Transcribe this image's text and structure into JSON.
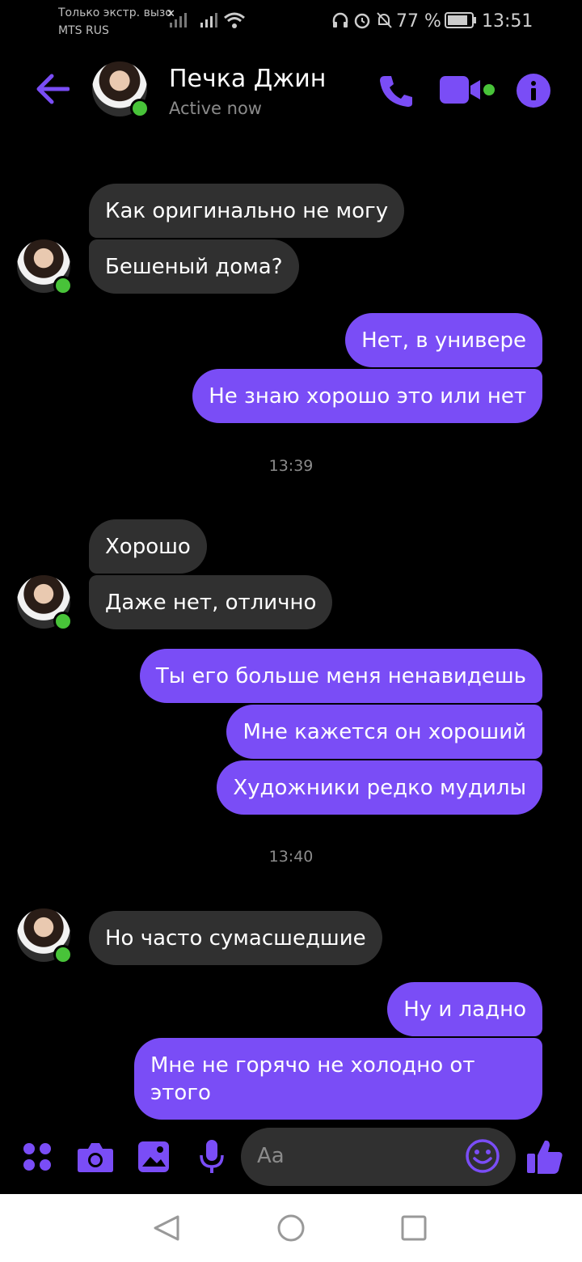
{
  "status_bar": {
    "carrier_line1": "Только экстр. вызо",
    "carrier_line2": "MTS RUS",
    "battery": "77 %",
    "time": "13:51"
  },
  "header": {
    "contact_name": "Печка Джин",
    "status": "Active now",
    "icons": [
      "back-arrow-icon",
      "phone-icon",
      "video-camera-icon",
      "info-icon"
    ]
  },
  "messages": [
    {
      "side": "in",
      "text": "Как оригинально не могу"
    },
    {
      "side": "in",
      "text": "Бешеный дома?"
    },
    {
      "side": "out",
      "text": "Нет, в универе"
    },
    {
      "side": "out",
      "text": "Не знаю хорошо это или нет"
    },
    {
      "timestamp": "13:39"
    },
    {
      "side": "in",
      "text": "Хорошо"
    },
    {
      "side": "in",
      "text": "Даже нет, отлично"
    },
    {
      "side": "out",
      "text": "Ты его больше меня ненавидешь"
    },
    {
      "side": "out",
      "text": "Мне кажется он хороший"
    },
    {
      "side": "out",
      "text": "Художники редко мудилы"
    },
    {
      "timestamp": "13:40"
    },
    {
      "side": "in",
      "text": "Но часто сумасшедшие"
    },
    {
      "side": "out",
      "text": "Ну и ладно"
    },
    {
      "side": "out",
      "text": "Мне не горячо не холодно от этого"
    }
  ],
  "composer": {
    "placeholder": "Aa",
    "icons": [
      "apps-icon",
      "camera-icon",
      "gallery-icon",
      "microphone-icon",
      "emoji-icon",
      "thumbs-up-icon"
    ]
  },
  "nav": {
    "icons": [
      "back-triangle-icon",
      "home-circle-icon",
      "recents-square-icon"
    ]
  },
  "colors": {
    "accent": "#7a4df6",
    "incoming_bubble": "#303030",
    "online": "#48c339"
  }
}
